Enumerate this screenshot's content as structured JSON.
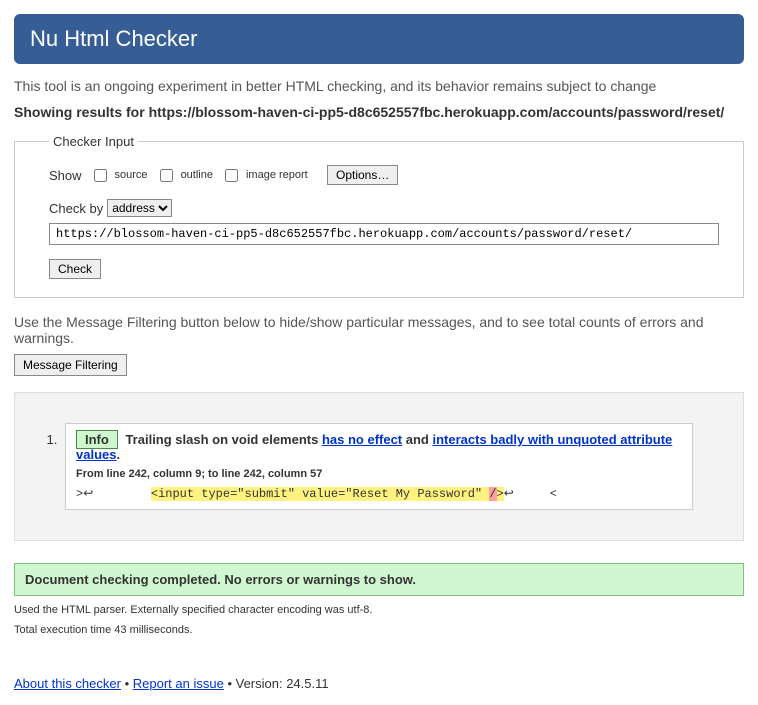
{
  "header": {
    "title": "Nu Html Checker"
  },
  "intro": "This tool is an ongoing experiment in better HTML checking, and its behavior remains subject to change",
  "results_heading_prefix": "Showing results for ",
  "results_url": "https://blossom-haven-ci-pp5-d8c652557fbc.herokuapp.com/accounts/password/reset/",
  "form": {
    "legend": "Checker Input",
    "show_label": "Show",
    "source_label": "source",
    "outline_label": "outline",
    "image_report_label": "image report",
    "options_button": "Options…",
    "check_by_label": "Check by",
    "check_by_selected": "address",
    "url_value": "https://blossom-haven-ci-pp5-d8c652557fbc.herokuapp.com/accounts/password/reset/",
    "check_button": "Check"
  },
  "filter": {
    "hint": "Use the Message Filtering button below to hide/show particular messages, and to see total counts of errors and warnings.",
    "button": "Message Filtering"
  },
  "message": {
    "badge": "Info",
    "text_prefix": "Trailing slash on void elements ",
    "link1": "has no effect",
    "text_mid": " and ",
    "link2": "interacts badly with unquoted attribute values",
    "text_suffix": ".",
    "location": "From line 242, column 9; to line 242, column 57",
    "code_pre": ">↩        ",
    "code_hl": "<input type=\"submit\" value=\"Reset My Password\" ",
    "code_slash": "/",
    "code_post": ">",
    "code_after": "↩     <"
  },
  "success": "Document checking completed. No errors or warnings to show.",
  "meta1": "Used the HTML parser. Externally specified character encoding was utf-8.",
  "meta2": "Total execution time 43 milliseconds.",
  "footer": {
    "about": "About this checker",
    "report": "Report an issue",
    "version_label": "Version: ",
    "version": "24.5.11"
  }
}
